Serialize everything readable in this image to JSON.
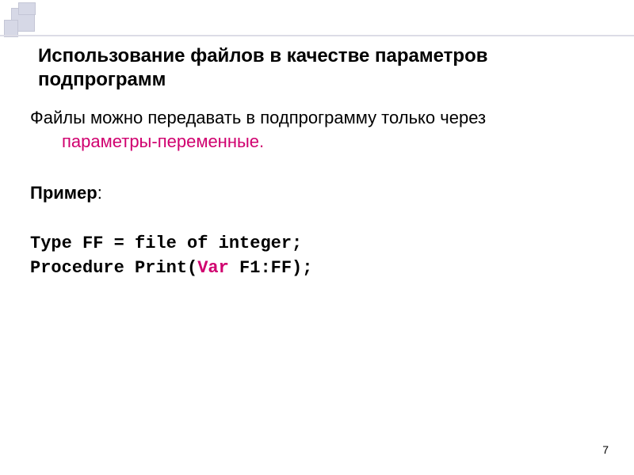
{
  "title": "Использование файлов в качестве параметров подпрограмм",
  "intro": {
    "line1": "Файлы можно передавать в подпрограмму только через",
    "line2": "параметры-переменные."
  },
  "example_label": "Пример",
  "colon": ":",
  "code": {
    "line1": "Type FF = file of integer;",
    "line2_a": "Procedure Print(",
    "line2_var": "Var",
    "line2_b": " F1:FF);"
  },
  "page_number": "7"
}
